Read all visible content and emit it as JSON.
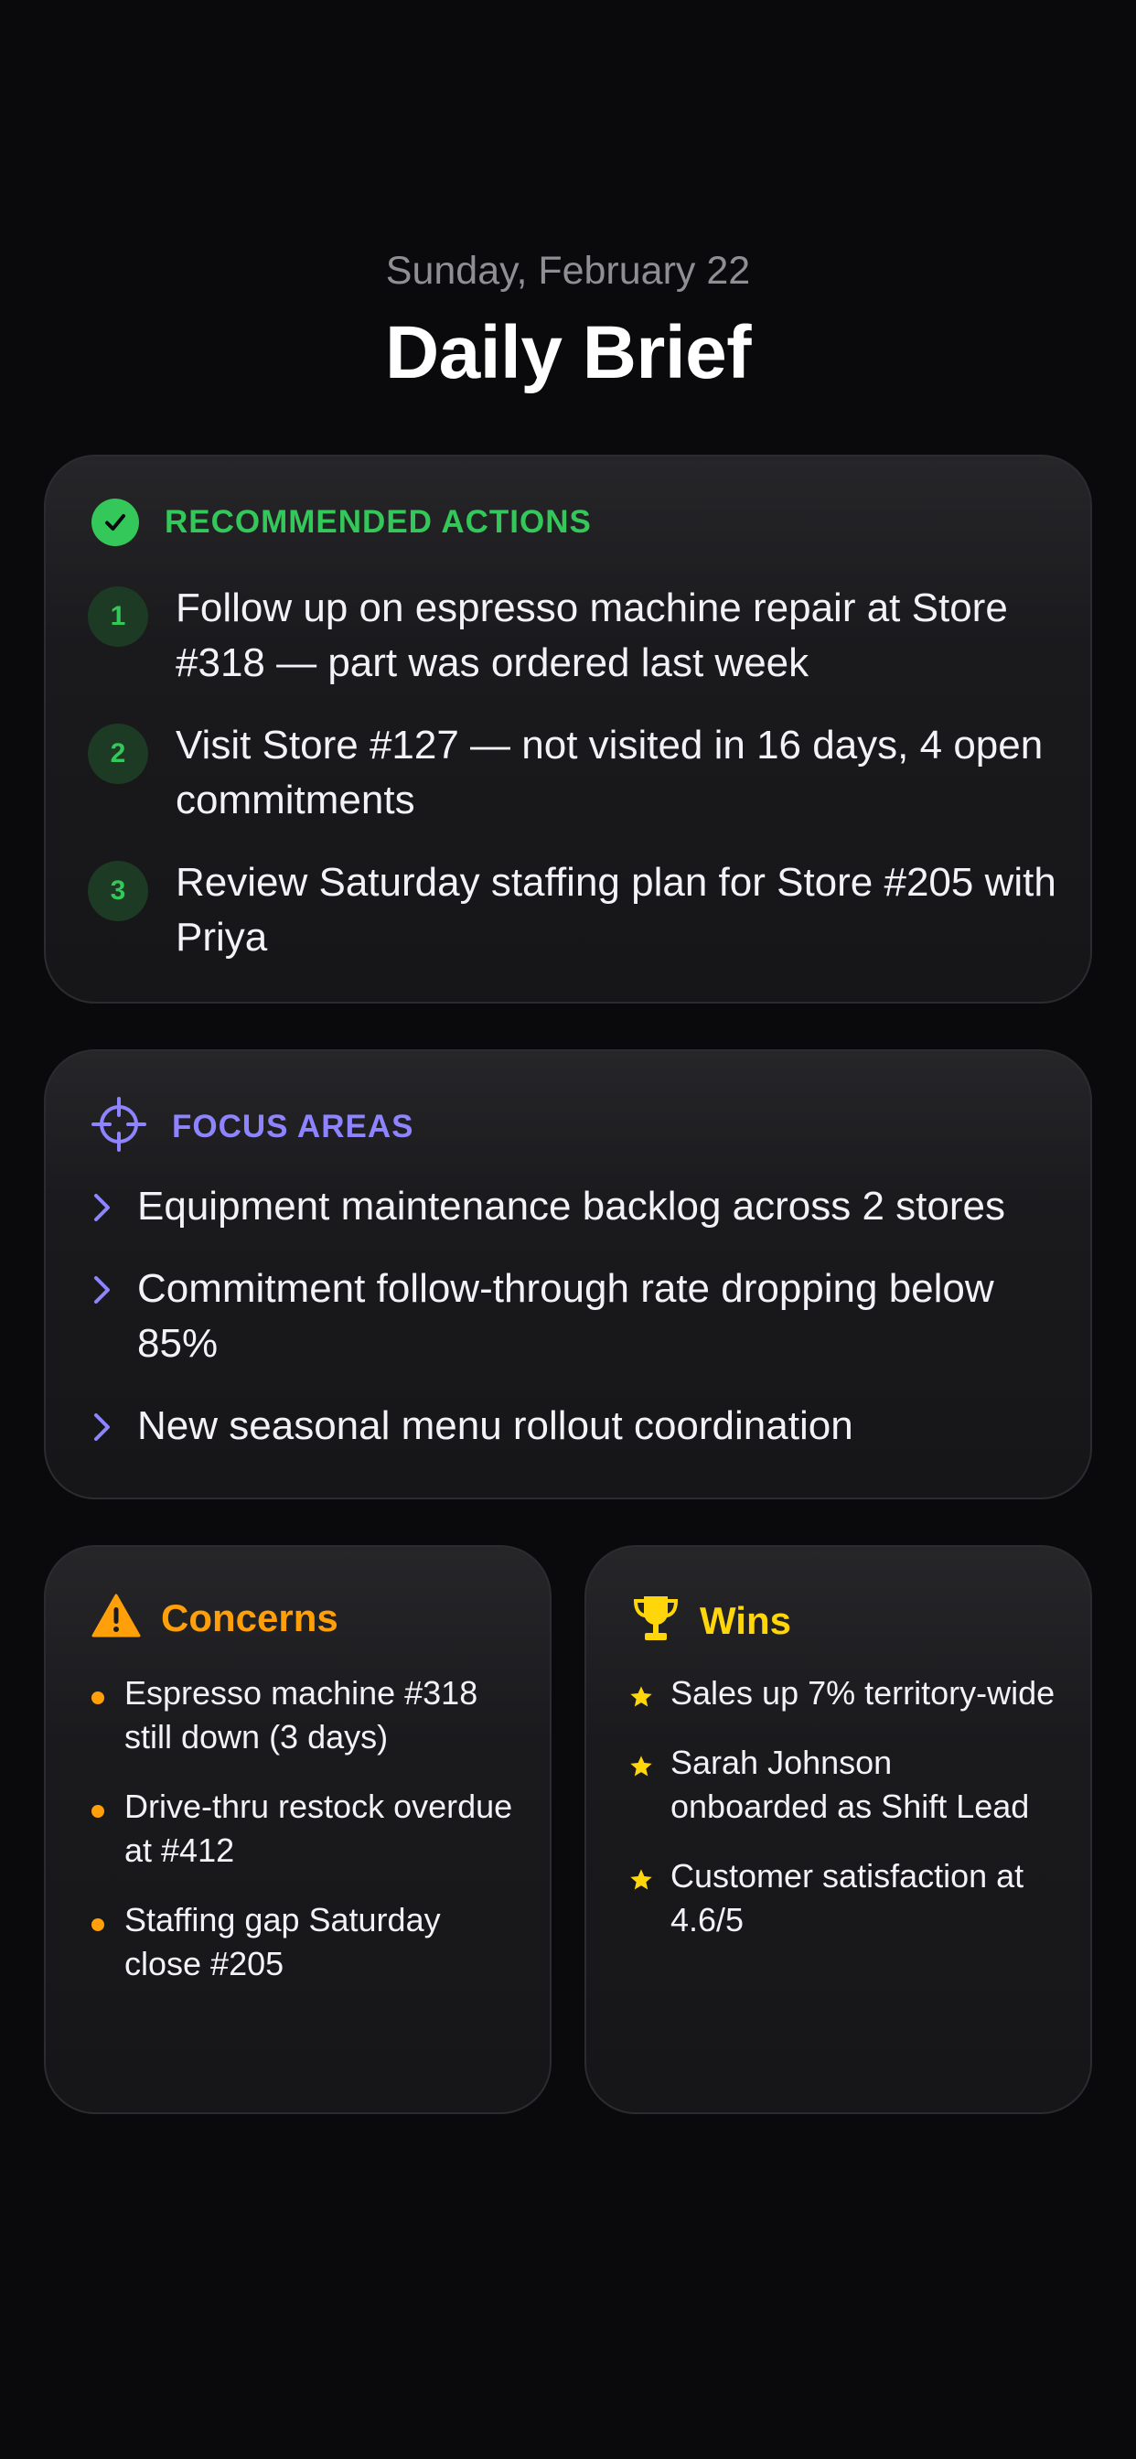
{
  "header": {
    "date": "Sunday, February 22",
    "title": "Daily Brief"
  },
  "actions": {
    "label": "RECOMMENDED ACTIONS",
    "icon": "checkmark-circle-icon",
    "items": [
      {
        "num": "1",
        "text": "Follow up on espresso machine repair at Store #318 — part was ordered last week"
      },
      {
        "num": "2",
        "text": "Visit Store #127 — not visited in 16 days, 4 open commitments"
      },
      {
        "num": "3",
        "text": "Review Saturday staffing plan for Store #205 with Priya"
      }
    ]
  },
  "focus": {
    "label": "FOCUS AREAS",
    "icon": "crosshair-icon",
    "items": [
      "Equipment maintenance backlog across 2 stores",
      "Commitment follow-through rate dropping below 85%",
      "New seasonal menu rollout coordination"
    ]
  },
  "concerns": {
    "label": "Concerns",
    "icon": "warning-triangle-icon",
    "items": [
      "Espresso machine #318 still down (3 days)",
      "Drive-thru restock overdue at #412",
      "Staffing gap Saturday close #205"
    ]
  },
  "wins": {
    "label": "Wins",
    "icon": "trophy-icon",
    "items": [
      "Sales up 7% territory-wide",
      "Sarah Johnson onboarded as Shift Lead",
      "Customer satisfaction at 4.6/5"
    ]
  },
  "colors": {
    "background": "#0a0a0c",
    "green": "#34c759",
    "purple": "#8e84ff",
    "orange": "#ff9f0a",
    "yellow": "#ffd60a"
  }
}
